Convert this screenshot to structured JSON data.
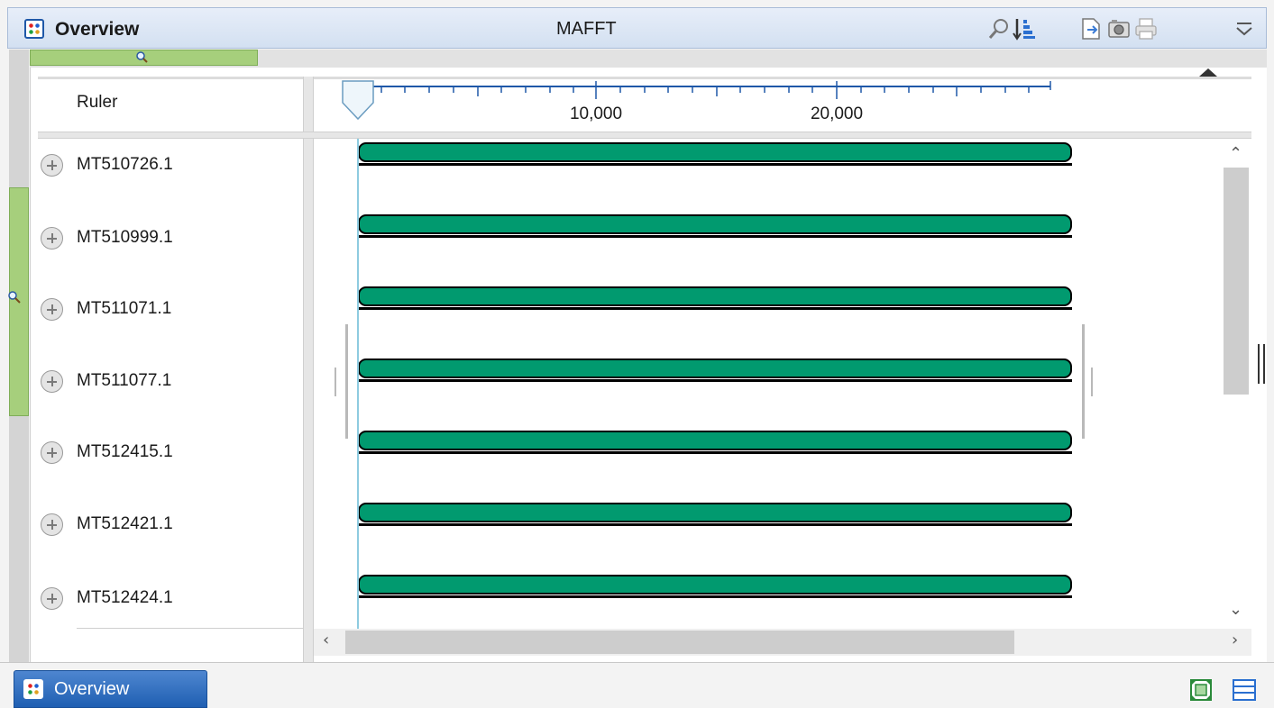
{
  "window": {
    "title": "Overview",
    "document_title": "MAFFT"
  },
  "toolbar": {
    "icons": [
      "search-icon",
      "sort-icon",
      "export-icon",
      "snapshot-icon",
      "print-icon",
      "menu-dropdown-icon"
    ]
  },
  "ruler": {
    "label": "Ruler",
    "ticks": [
      "10,000",
      "20,000"
    ]
  },
  "sequences": [
    {
      "name": "MT510726.1"
    },
    {
      "name": "MT510999.1"
    },
    {
      "name": "MT511071.1"
    },
    {
      "name": "MT511077.1"
    },
    {
      "name": "MT512415.1"
    },
    {
      "name": "MT512421.1"
    },
    {
      "name": "MT512424.1"
    }
  ],
  "bottom_tab": {
    "label": "Overview"
  },
  "colors": {
    "sequence_fill": "#019a6f",
    "overview_green": "#a6cf7c",
    "tab_blue": "#1f5fb2",
    "cursor": "#8ecbe0"
  }
}
